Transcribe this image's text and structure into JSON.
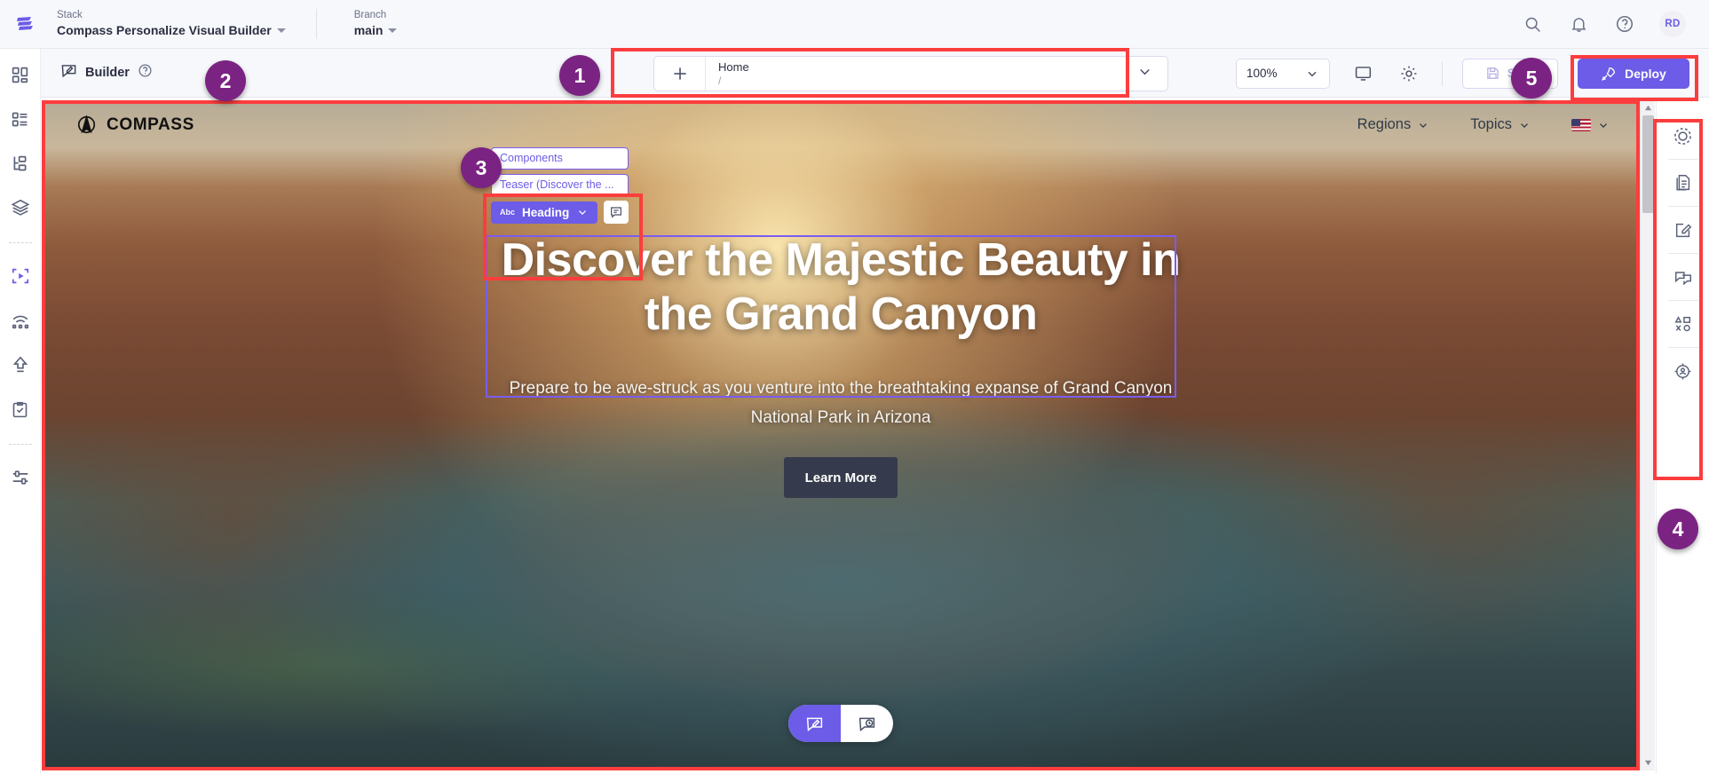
{
  "header": {
    "logo_icon": "contentstack-logo-icon",
    "stack": {
      "label": "Stack",
      "value": "Compass Personalize Visual Builder"
    },
    "branch": {
      "label": "Branch",
      "value": "main"
    },
    "actions": [
      {
        "name": "search-icon",
        "label": "Search"
      },
      {
        "name": "notification-bell-icon",
        "label": "Notifications"
      },
      {
        "name": "help-circle-icon",
        "label": "Help"
      }
    ],
    "avatar_initials": "RD"
  },
  "toolbar": {
    "builder_label": "Builder",
    "builder_icon": "builder-pencil-icon",
    "help_icon": "help-circle-icon",
    "page_selector": {
      "add_icon": "plus-icon",
      "title": "Home",
      "path": "/",
      "caret_icon": "chevron-down-icon"
    },
    "zoom": {
      "value": "100%",
      "caret_icon": "chevron-down-icon"
    },
    "device_icon": "monitor-icon",
    "settings_icon": "gear-icon",
    "save": {
      "label": "Save",
      "icon": "floppy-disk-icon"
    },
    "deploy": {
      "label": "Deploy",
      "icon": "rocket-icon"
    }
  },
  "left_rail": {
    "items": [
      {
        "name": "sidebar-dashboard-icon",
        "active": false
      },
      {
        "name": "sidebar-content-types-icon",
        "active": false
      },
      {
        "name": "sidebar-taxonomy-icon",
        "active": false
      },
      {
        "name": "sidebar-assets-icon",
        "active": false
      },
      {
        "name": "sidebar-visual-builder-icon",
        "active": true
      },
      {
        "name": "sidebar-live-preview-icon",
        "active": false
      },
      {
        "name": "sidebar-releases-icon",
        "active": false
      },
      {
        "name": "sidebar-tasks-icon",
        "active": false
      },
      {
        "name": "sidebar-settings-sliders-icon",
        "active": false
      }
    ]
  },
  "right_rail": {
    "items": [
      {
        "name": "rail-personalize-icon"
      },
      {
        "name": "rail-content-icon"
      },
      {
        "name": "rail-edit-icon"
      },
      {
        "name": "rail-comments-icon"
      },
      {
        "name": "rail-variants-icon"
      },
      {
        "name": "rail-audience-icon"
      }
    ]
  },
  "canvas": {
    "site_nav": {
      "brand": "COMPASS",
      "brand_icon": "compass-logo-icon",
      "links": [
        {
          "label": "Regions",
          "caret_icon": "chevron-down-icon"
        },
        {
          "label": "Topics",
          "caret_icon": "chevron-down-icon"
        }
      ],
      "locale": {
        "flag_icon": "us-flag-icon",
        "caret_icon": "chevron-down-icon"
      }
    },
    "component_badges": {
      "components_label": "Components",
      "teaser_label": "Teaser (Discover the ...",
      "active_label": "Heading",
      "active_prefix": "Abc",
      "active_caret_icon": "chevron-down-icon",
      "note_icon": "comment-icon"
    },
    "hero": {
      "title": "Discover the Majestic Beauty in the Grand Canyon",
      "subtitle": "Prepare to be awe-struck as you venture into the breathtaking expanse of Grand Canyon National Park in Arizona",
      "cta_label": "Learn More"
    },
    "mode_pill": {
      "edit_icon": "builder-edit-mode-icon",
      "preview_icon": "builder-preview-mode-icon"
    },
    "scroll": {
      "up_icon": "scroll-up-arrow-icon",
      "down_icon": "scroll-down-arrow-icon"
    }
  },
  "annotations": {
    "colors": {
      "box": "#fc3d3d",
      "badge": "#7b2382",
      "accent": "#6c5ce7"
    },
    "numbers": [
      {
        "id": "1",
        "label": "1"
      },
      {
        "id": "2",
        "label": "2"
      },
      {
        "id": "3",
        "label": "3"
      },
      {
        "id": "4",
        "label": "4"
      },
      {
        "id": "5",
        "label": "5"
      }
    ]
  }
}
